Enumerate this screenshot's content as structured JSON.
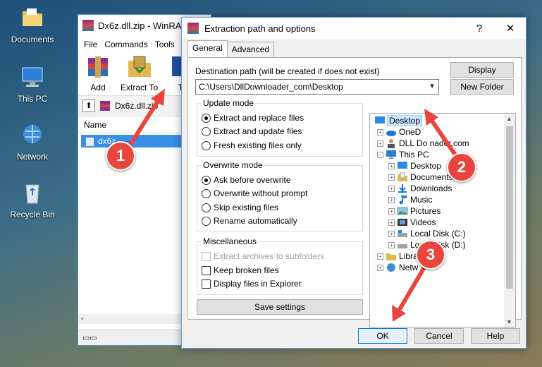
{
  "colors": {
    "accent": "#3a8ee6",
    "annotation": "#e8453c",
    "selection": "#cce8ff"
  },
  "desktop": {
    "icons": [
      {
        "label": "Documents",
        "icon": "folder-icon"
      },
      {
        "label": "This PC",
        "icon": "computer-icon"
      },
      {
        "label": "Network",
        "icon": "network-icon"
      },
      {
        "label": "Recycle Bin",
        "icon": "recycle-bin-icon"
      }
    ]
  },
  "winrar": {
    "title": "Dx6z.dll.zip - WinRA",
    "menu": [
      "File",
      "Commands",
      "Tools"
    ],
    "tools": [
      {
        "label": "Add"
      },
      {
        "label": "Extract To"
      },
      {
        "label": "T"
      }
    ],
    "path": "Dx6z.dll.zip",
    "column_name": "Name",
    "row": "dx6z"
  },
  "dialog": {
    "title": "Extraction path and options",
    "help": "?",
    "close": "✕",
    "tabs": [
      "General",
      "Advanced"
    ],
    "dest_label": "Destination path (will be created if does not exist)",
    "dest_value": "C:\\Users\\DllDownloader_com\\Desktop",
    "display_btn": "Display",
    "new_folder_btn": "New Folder",
    "update_mode": {
      "title": "Update mode",
      "options": [
        "Extract and replace files",
        "Extract and update files",
        "Fresh existing files only"
      ],
      "selected": 0
    },
    "overwrite_mode": {
      "title": "Overwrite mode",
      "options": [
        "Ask before overwrite",
        "Overwrite without prompt",
        "Skip existing files",
        "Rename automatically"
      ],
      "selected": 0
    },
    "misc": {
      "title": "Miscellaneous",
      "options": [
        "Extract archives to subfolders",
        "Keep broken files",
        "Display files in Explorer"
      ]
    },
    "save_btn": "Save settings",
    "tree": [
      "Desktop",
      "OneD",
      "DLL Do     nader.com",
      "This PC",
      "Desktop",
      "Documents",
      "Downloads",
      "Music",
      "Pictures",
      "Videos",
      "Local Disk (C:)",
      "Local Disk (D:)",
      "Librar",
      "Netw"
    ],
    "ok_btn": "OK",
    "cancel_btn": "Cancel",
    "help_btn": "Help"
  },
  "markers": [
    "1",
    "2",
    "3"
  ]
}
